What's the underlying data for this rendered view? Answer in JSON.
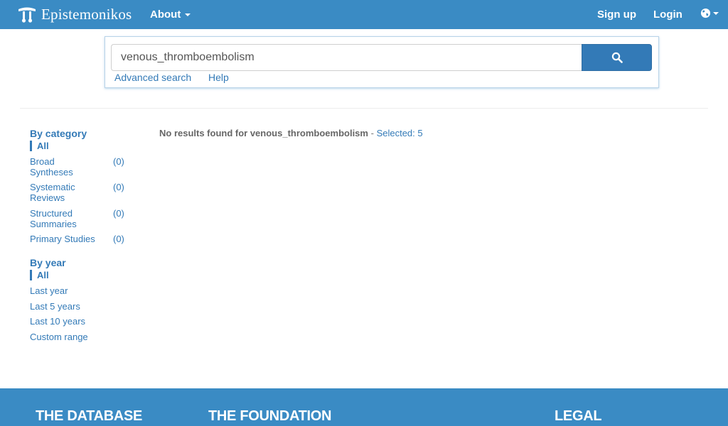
{
  "navbar": {
    "brand": "Epistemonikos",
    "about": "About",
    "signup": "Sign up",
    "login": "Login",
    "language_icon": "globe-icon"
  },
  "search": {
    "query": "venous_thromboembolism",
    "button_icon": "search-icon",
    "advanced": "Advanced search",
    "help": "Help"
  },
  "sidebar": {
    "category": {
      "title": "By category",
      "active": "All",
      "items": [
        {
          "label": "Broad Syntheses",
          "count": "(0)"
        },
        {
          "label": "Systematic Reviews",
          "count": "(0)"
        },
        {
          "label": "Structured Summaries",
          "count": "(0)"
        },
        {
          "label": "Primary Studies",
          "count": "(0)"
        }
      ]
    },
    "year": {
      "title": "By year",
      "active": "All",
      "items": [
        {
          "label": "Last year"
        },
        {
          "label": "Last 5 years"
        },
        {
          "label": "Last 10 years"
        },
        {
          "label": "Custom range"
        }
      ]
    }
  },
  "results": {
    "message": "No results found for venous_thromboembolism",
    "separator": "-",
    "selected": "Selected: 5"
  },
  "footer": {
    "database": "THE DATABASE",
    "foundation": "THE FOUNDATION",
    "legal": "LEGAL"
  },
  "colors": {
    "navbar": "#3a8bc4",
    "link": "#337ab7",
    "button": "#337ab7"
  }
}
